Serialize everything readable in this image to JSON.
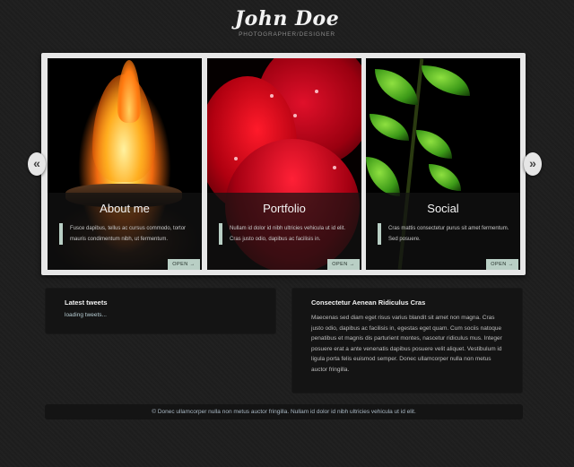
{
  "header": {
    "logo": "John Doe",
    "tagline": "PHOTOGRAPHER/DESIGNER"
  },
  "slider": {
    "prev_icon": "«",
    "next_icon": "»",
    "panels": [
      {
        "title": "About me",
        "text": "Fusce dapibus, tellus ac cursus commodo, tortor mauris condimentum nibh, ut fermentum.",
        "button": "OPEN →"
      },
      {
        "title": "Portfolio",
        "text": "Nullam id dolor id nibh ultricies vehicula ut id elit. Cras justo odio, dapibus ac facilisis in.",
        "button": "OPEN →"
      },
      {
        "title": "Social",
        "text": "Cras mattis consectetur purus sit amet fermentum. Sed posuere.",
        "button": "OPEN →"
      }
    ]
  },
  "tweets": {
    "title": "Latest tweets",
    "status": "loading tweets..."
  },
  "info": {
    "title": "Consectetur Aenean Ridiculus Cras",
    "text": "Maecenas sed diam eget risus varius blandit sit amet non magna. Cras justo odio, dapibus ac facilisis in, egestas eget quam. Cum sociis natoque penatibus et magnis dis parturient montes, nascetur ridiculus mus. Integer posuere erat a ante venenatis dapibus posuere velit aliquet. Vestibulum id ligula porta felis euismod semper. Donec ullamcorper nulla non metus auctor fringilla."
  },
  "footer": {
    "text": "© Donec ullamcorper nulla non metus auctor fringilla. Nullam id dolor id nibh ultricies vehicula ut id elit."
  }
}
